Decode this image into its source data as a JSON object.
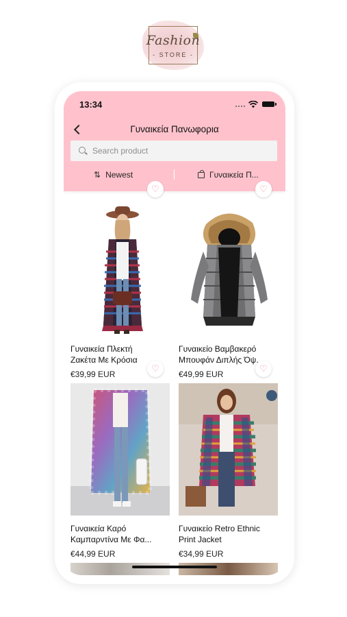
{
  "logo": {
    "script": "Fashion",
    "store": "- STORE -"
  },
  "status": {
    "time": "13:34"
  },
  "header": {
    "title": "Γυναικεία Πανωφορια"
  },
  "search": {
    "placeholder": "Search product"
  },
  "toolbar": {
    "sort_label": "Newest",
    "filter_label": "Γυναικεία Π..."
  },
  "products": [
    {
      "name_line1": "Γυναικεία Πλεκτή",
      "name_line2": "Ζακέτα Με Κρόσια",
      "price": "€39,99 EUR"
    },
    {
      "name_line1": "Γυναικείο Βαμβακερό",
      "name_line2": "Μπουφάν Διπλής Όψ...",
      "price": "€49,99 EUR"
    },
    {
      "name_line1": "Γυναικεία Καρό",
      "name_line2": "Καμπαρντίνα Με Φα...",
      "price": "€44,99 EUR"
    },
    {
      "name_line1": "Γυναικείο Retro Ethnic",
      "name_line2": "Print Jacket",
      "price": "€34,99 EUR"
    }
  ],
  "colors": {
    "header_bg": "#ffc2cc",
    "heart": "#f08da0"
  },
  "icons": [
    "back-icon",
    "search-icon",
    "sort-icon",
    "bag-icon",
    "heart-icon",
    "wifi-icon",
    "battery-icon"
  ]
}
